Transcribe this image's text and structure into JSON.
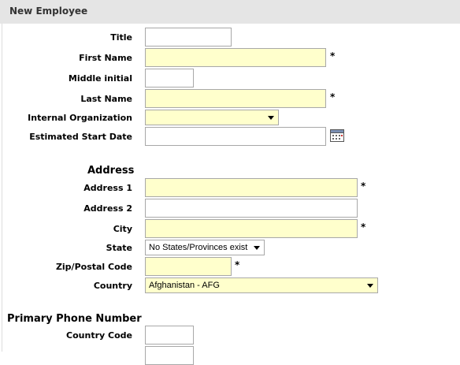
{
  "header": {
    "title": "New Employee"
  },
  "form": {
    "title_label": "Title",
    "first_name_label": "First Name",
    "middle_initial_label": "Middle initial",
    "last_name_label": "Last Name",
    "internal_org_label": "Internal Organization",
    "internal_org_value": "",
    "start_date_label": "Estimated Start Date",
    "address_section": "Address",
    "address1_label": "Address 1",
    "address2_label": "Address 2",
    "city_label": "City",
    "state_label": "State",
    "state_value": "No States/Provinces exist",
    "zip_label": "Zip/Postal Code",
    "country_label": "Country",
    "country_value": "Afghanistan - AFG",
    "phone_section": "Primary Phone Number",
    "country_code_label": "Country Code",
    "required_marker": "*"
  },
  "colors": {
    "required_bg": "#ffffcc",
    "header_bg": "#e5e5e5"
  },
  "icons": {
    "date_picker": "calendar-icon"
  }
}
